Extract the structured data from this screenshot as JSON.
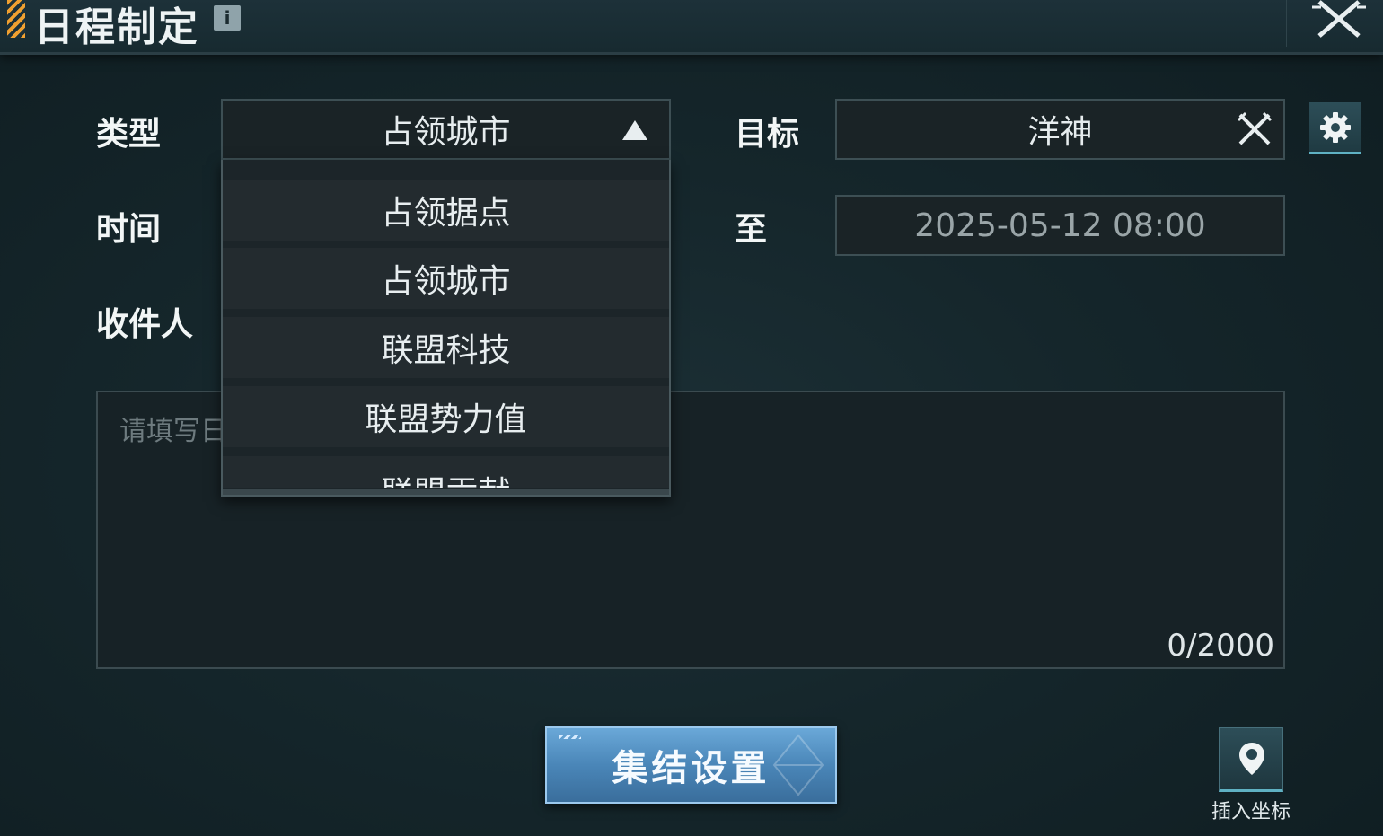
{
  "header": {
    "title": "日程制定",
    "info_icon": "i",
    "close_icon": "close-icon"
  },
  "form": {
    "type_label": "类型",
    "type_value": "占领城市",
    "target_label": "目标",
    "target_value": "洋神",
    "time_label": "时间",
    "to_label": "至",
    "end_time": "2025-05-12 08:00",
    "recipient_label": "收件人",
    "content_placeholder": "请填写日",
    "char_count": "0/2000"
  },
  "dropdown": {
    "options": [
      "占领据点",
      "占领城市",
      "联盟科技",
      "联盟势力值",
      "联盟贡献"
    ]
  },
  "actions": {
    "rally_button": "集结设置",
    "insert_coords_label": "插入坐标"
  },
  "colors": {
    "accent_orange": "#f0a030",
    "button_blue": "#4a86b8",
    "teal_underline": "#5fb1c3"
  }
}
